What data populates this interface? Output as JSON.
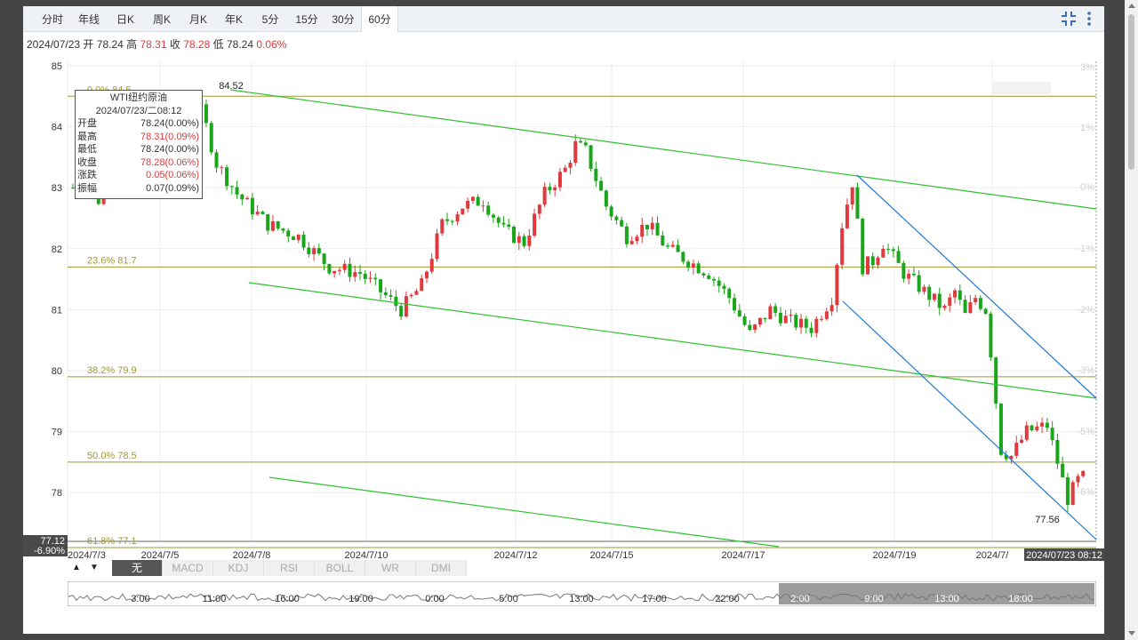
{
  "tabs": [
    "分时",
    "年线",
    "日K",
    "周K",
    "月K",
    "年K",
    "5分",
    "15分",
    "30分",
    "60分"
  ],
  "active_tab": 9,
  "ohlc_bar": {
    "date": "2024/07/23",
    "open_label": "开",
    "open": "78.24",
    "high_label": "高",
    "high": "78.31",
    "close_label": "收",
    "close": "78.28",
    "low_label": "低",
    "low": "78.24",
    "change_pct": "0.06%"
  },
  "tooltip": {
    "title": "WTI纽约原油",
    "datetime": "2024/07/23/二08:12",
    "rows": [
      {
        "label": "开盘",
        "value": "78.24(0.00%)",
        "color": "normal"
      },
      {
        "label": "最高",
        "value": "78.31(0.09%)",
        "color": "red"
      },
      {
        "label": "最低",
        "value": "78.24(0.00%)",
        "color": "normal"
      },
      {
        "label": "收盘",
        "value": "78.28(0.06%)",
        "color": "red"
      },
      {
        "label": "涨跌",
        "value": "0.05(0.06%)",
        "color": "red"
      },
      {
        "label": "振幅",
        "value": "0.07(0.09%)",
        "color": "normal"
      }
    ]
  },
  "chart_data": {
    "type": "candlestick",
    "y_ticks": [
      "85",
      "84",
      "83",
      "82",
      "81",
      "80",
      "79",
      "78"
    ],
    "right_ticks": [
      "3%",
      "1%",
      "0%",
      "-1%",
      "-2%",
      "-3%",
      "-5%",
      "-6%"
    ],
    "x_labels": [
      "2024/7/3",
      "2024/7/5",
      "2024/7/8",
      "2024/7/10",
      "2024/7/12",
      "2024/7/15",
      "2024/7/17",
      "2024/7/19",
      "2024/7/"
    ],
    "fib_levels": [
      {
        "label": "0.0% 84.5",
        "value": 84.5
      },
      {
        "label": "23.6% 81.7",
        "value": 81.7
      },
      {
        "label": "38.2% 79.9",
        "value": 79.9
      },
      {
        "label": "50.0% 78.5",
        "value": 78.5
      },
      {
        "label": "61.8% 77.1",
        "value": 77.1
      }
    ],
    "high_label": "84.52",
    "low_label": "77.56",
    "cursor_price": "77.12",
    "cursor_pct": "-6.90%",
    "cursor_time": "2024/07/23 08:12",
    "close_path": [
      [
        0,
        83.0
      ],
      [
        2,
        83.4
      ],
      [
        5,
        82.8
      ],
      [
        9,
        83.3
      ],
      [
        13,
        83.6
      ],
      [
        16,
        83.9
      ],
      [
        19,
        84.2
      ],
      [
        22,
        84.3
      ],
      [
        24,
        84.5
      ],
      [
        26,
        84.0
      ],
      [
        28,
        83.4
      ],
      [
        32,
        82.9
      ],
      [
        38,
        82.4
      ],
      [
        44,
        82.2
      ],
      [
        50,
        81.7
      ],
      [
        56,
        81.6
      ],
      [
        60,
        81.3
      ],
      [
        64,
        81.0
      ],
      [
        68,
        81.4
      ],
      [
        72,
        82.4
      ],
      [
        76,
        82.7
      ],
      [
        80,
        82.8
      ],
      [
        84,
        82.3
      ],
      [
        88,
        82.1
      ],
      [
        92,
        82.9
      ],
      [
        96,
        83.3
      ],
      [
        98,
        83.7
      ],
      [
        100,
        83.6
      ],
      [
        104,
        82.7
      ],
      [
        108,
        82.2
      ],
      [
        112,
        82.4
      ],
      [
        116,
        82.0
      ],
      [
        120,
        81.8
      ],
      [
        124,
        81.6
      ],
      [
        128,
        81.2
      ],
      [
        132,
        80.6
      ],
      [
        136,
        81.0
      ],
      [
        140,
        80.8
      ],
      [
        144,
        80.7
      ],
      [
        148,
        81.2
      ],
      [
        150,
        82.4
      ],
      [
        152,
        83.1
      ],
      [
        154,
        81.7
      ],
      [
        156,
        81.8
      ],
      [
        158,
        82.1
      ],
      [
        162,
        81.6
      ],
      [
        166,
        81.3
      ],
      [
        170,
        81.0
      ],
      [
        172,
        81.3
      ],
      [
        174,
        80.9
      ],
      [
        176,
        81.2
      ],
      [
        178,
        81.0
      ],
      [
        179,
        80.3
      ],
      [
        181,
        78.7
      ],
      [
        183,
        78.6
      ],
      [
        186,
        79.0
      ],
      [
        190,
        79.1
      ],
      [
        192,
        78.5
      ],
      [
        194,
        77.9
      ],
      [
        196,
        78.2
      ],
      [
        198,
        78.3
      ]
    ],
    "channel_lines": [
      [
        [
          0,
          84.52
        ],
        [
          1,
          84.52
        ]
      ]
    ]
  },
  "indicator_tabs": [
    "无",
    "MACD",
    "KDJ",
    "RSI",
    "BOLL",
    "WR",
    "DMI"
  ],
  "active_indicator": 0,
  "nav_ticks": [
    "3:00",
    "11:00",
    "16:00",
    "19:00",
    "0:00",
    "5:00",
    "13:00",
    "17:00",
    "22:00",
    "2:00",
    "9:00",
    "13:00",
    "18:00"
  ],
  "colors": {
    "up": "#e0393e",
    "down": "#1aa51a",
    "fib": "#a09a30",
    "channel_green": "#2fc22f",
    "channel_blue": "#1e78d6"
  }
}
